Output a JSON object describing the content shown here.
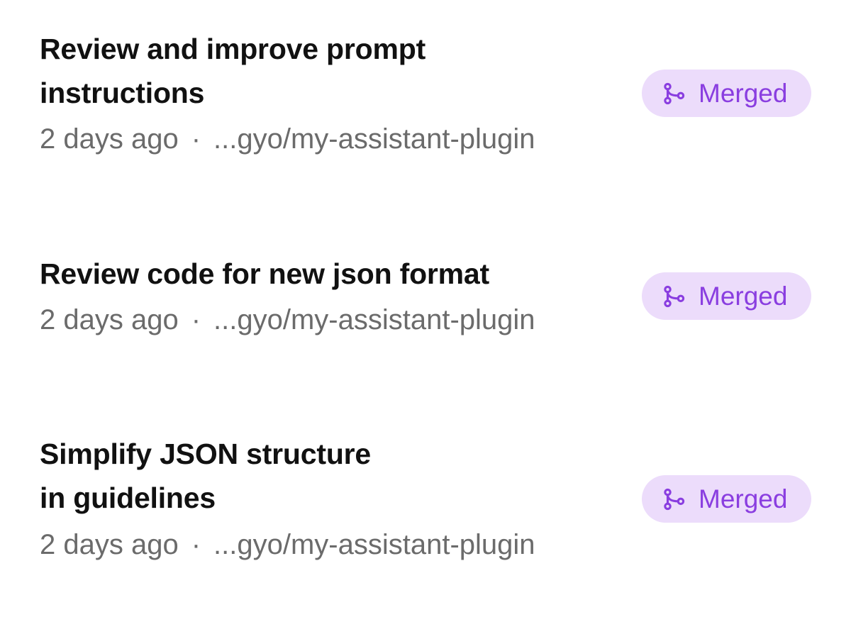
{
  "sessions": [
    {
      "title_lines": [
        "Review and improve prompt",
        "instructions"
      ],
      "time": "2 days ago",
      "separator": "·",
      "repo": "...gyo/my-assistant-plugin",
      "status": "Merged"
    },
    {
      "title_lines": [
        "Review code for new json format"
      ],
      "time": "2 days ago",
      "separator": "·",
      "repo": "...gyo/my-assistant-plugin",
      "status": "Merged"
    },
    {
      "title_lines": [
        "Simplify JSON structure",
        "in guidelines"
      ],
      "time": "2 days ago",
      "separator": "·",
      "repo": "...gyo/my-assistant-plugin",
      "status": "Merged"
    }
  ],
  "colors": {
    "badge_background": "#ecdcfb",
    "badge_text": "#8a3ee0",
    "title_text": "#111111",
    "meta_text": "#6b6b6b"
  },
  "icons": {
    "status": "git-merge-icon"
  }
}
